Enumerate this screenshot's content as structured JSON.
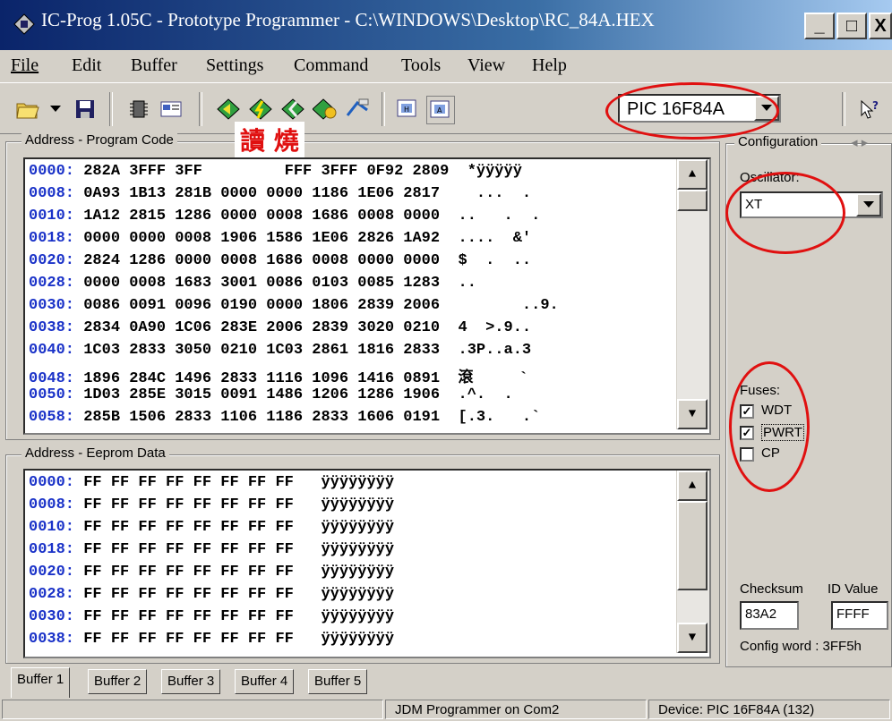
{
  "window": {
    "title": "IC-Prog 1.05C - Prototype Programmer - C:\\WINDOWS\\Desktop\\RC_84A.HEX",
    "minimize": "_",
    "maximize": "□",
    "close": "X"
  },
  "menu": [
    "File",
    "Edit",
    "Buffer",
    "Settings",
    "Command",
    "Tools",
    "View",
    "Help"
  ],
  "menu_underline_index": [
    0,
    0,
    0,
    0,
    0,
    0,
    0,
    0
  ],
  "toolbar": {
    "device": "PIC 16F84A",
    "help_icon": "help-pointer-icon"
  },
  "annotation_text": "讀 燒",
  "program_code": {
    "label": "Address - Program Code",
    "rows": [
      {
        "addr": "0000:",
        "hex": "282A 3FFF 3FF         FFF 3FFF 0F92 2809",
        "ascii": "*ÿÿÿÿÿ"
      },
      {
        "addr": "0008:",
        "hex": "0A93 1B13 281B 0000 0000 1186 1E06 2817",
        "ascii": "  ...  ."
      },
      {
        "addr": "0010:",
        "hex": "1A12 2815 1286 0000 0008 1686 0008 0000",
        "ascii": "..   .  ."
      },
      {
        "addr": "0018:",
        "hex": "0000 0000 0008 1906 1586 1E06 2826 1A92",
        "ascii": "....  &'"
      },
      {
        "addr": "0020:",
        "hex": "2824 1286 0000 0008 1686 0008 0000 0000",
        "ascii": "$  .  .."
      },
      {
        "addr": "0028:",
        "hex": "0000 0008 1683 3001 0086 0103 0085 1283",
        "ascii": ".."
      },
      {
        "addr": "0030:",
        "hex": "0086 0091 0096 0190 0000 1806 2839 2006",
        "ascii": "       ..9."
      },
      {
        "addr": "0038:",
        "hex": "2834 0A90 1C06 283E 2006 2839 3020 0210",
        "ascii": "4  >.9.."
      },
      {
        "addr": "0040:",
        "hex": "1C03 2833 3050 0210 1C03 2861 1816 2833",
        "ascii": ".3P..a.3"
      },
      {
        "addr": "0048:",
        "hex": "1896 284C 1496 2833 1116 1096 1416 0891",
        "ascii": "滾     `"
      },
      {
        "addr": "0050:",
        "hex": "1D03 285E 3015 0091 1486 1206 1286 1906",
        "ascii": ".^.  ."
      },
      {
        "addr": "0058:",
        "hex": "285B 1506 2833 1106 1186 2833 1606 0191",
        "ascii": "[.3.   .`"
      }
    ]
  },
  "eeprom": {
    "label": "Address - Eeprom Data",
    "rows": [
      {
        "addr": "0000:",
        "hex": "FF FF FF FF FF FF FF FF",
        "ascii": "ÿÿÿÿÿÿÿÿ"
      },
      {
        "addr": "0008:",
        "hex": "FF FF FF FF FF FF FF FF",
        "ascii": "ÿÿÿÿÿÿÿÿ"
      },
      {
        "addr": "0010:",
        "hex": "FF FF FF FF FF FF FF FF",
        "ascii": "ÿÿÿÿÿÿÿÿ"
      },
      {
        "addr": "0018:",
        "hex": "FF FF FF FF FF FF FF FF",
        "ascii": "ÿÿÿÿÿÿÿÿ"
      },
      {
        "addr": "0020:",
        "hex": "FF FF FF FF FF FF FF FF",
        "ascii": "ÿÿÿÿÿÿÿÿ"
      },
      {
        "addr": "0028:",
        "hex": "FF FF FF FF FF FF FF FF",
        "ascii": "ÿÿÿÿÿÿÿÿ"
      },
      {
        "addr": "0030:",
        "hex": "FF FF FF FF FF FF FF FF",
        "ascii": "ÿÿÿÿÿÿÿÿ"
      },
      {
        "addr": "0038:",
        "hex": "FF FF FF FF FF FF FF FF",
        "ascii": "ÿÿÿÿÿÿÿÿ"
      }
    ]
  },
  "config": {
    "label": "Configuration",
    "oscillator_label": "Oscillator:",
    "oscillator_value": "XT",
    "fuses_label": "Fuses:",
    "fuses": [
      {
        "name": "WDT",
        "checked": true
      },
      {
        "name": "PWRT",
        "checked": true
      },
      {
        "name": "CP",
        "checked": false
      }
    ],
    "checksum_label": "Checksum",
    "checksum_value": "83A2",
    "id_label": "ID Value",
    "id_value": "FFFF",
    "config_word": "Config word : 3FF5h"
  },
  "tabs": [
    "Buffer 1",
    "Buffer 2",
    "Buffer 3",
    "Buffer 4",
    "Buffer 5"
  ],
  "active_tab": 0,
  "status": {
    "programmer": "JDM Programmer on Com2",
    "device": "Device: PIC 16F84A  (132)"
  },
  "colors": {
    "address": "#1a32c8",
    "annotation": "#e01010",
    "titlebar": "#0a246a"
  }
}
